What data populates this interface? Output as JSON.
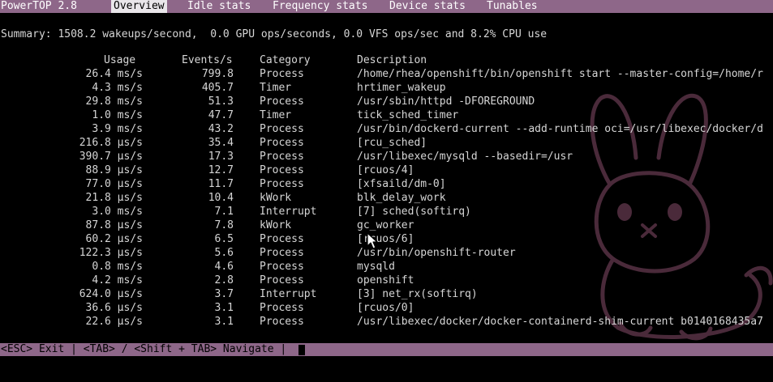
{
  "app": {
    "title": "PowerTOP 2.8"
  },
  "tabs": [
    {
      "label": "Overview",
      "active": true
    },
    {
      "label": "Idle stats",
      "active": false
    },
    {
      "label": "Frequency stats",
      "active": false
    },
    {
      "label": "Device stats",
      "active": false
    },
    {
      "label": "Tunables",
      "active": false
    }
  ],
  "summary": "Summary: 1508.2 wakeups/second,  0.0 GPU ops/seconds, 0.0 VFS ops/sec and 8.2% CPU use",
  "table": {
    "headers": {
      "usage": "Usage",
      "events": "Events/s",
      "category": "Category",
      "description": "Description"
    },
    "rows": [
      {
        "usage": "26.4 ms/s",
        "events": "799.8",
        "category": "Process",
        "description": "/home/rhea/openshift/bin/openshift start --master-config=/home/r"
      },
      {
        "usage": "4.3 ms/s",
        "events": "405.7",
        "category": "Timer",
        "description": "hrtimer_wakeup"
      },
      {
        "usage": "29.8 ms/s",
        "events": "51.3",
        "category": "Process",
        "description": "/usr/sbin/httpd -DFOREGROUND"
      },
      {
        "usage": "1.0 ms/s",
        "events": "47.7",
        "category": "Timer",
        "description": "tick_sched_timer"
      },
      {
        "usage": "3.9 ms/s",
        "events": "43.2",
        "category": "Process",
        "description": "/usr/bin/dockerd-current --add-runtime oci=/usr/libexec/docker/d"
      },
      {
        "usage": "216.8 µs/s",
        "events": "35.4",
        "category": "Process",
        "description": "[rcu_sched]"
      },
      {
        "usage": "390.7 µs/s",
        "events": "17.3",
        "category": "Process",
        "description": "/usr/libexec/mysqld --basedir=/usr"
      },
      {
        "usage": "88.9 µs/s",
        "events": "12.7",
        "category": "Process",
        "description": "[rcuos/4]"
      },
      {
        "usage": "77.0 µs/s",
        "events": "11.7",
        "category": "Process",
        "description": "[xfsaild/dm-0]"
      },
      {
        "usage": "21.8 µs/s",
        "events": "10.4",
        "category": "kWork",
        "description": "blk_delay_work"
      },
      {
        "usage": "3.0 ms/s",
        "events": "7.1",
        "category": "Interrupt",
        "description": "[7] sched(softirq)"
      },
      {
        "usage": "87.8 µs/s",
        "events": "7.8",
        "category": "kWork",
        "description": "gc_worker"
      },
      {
        "usage": "60.2 µs/s",
        "events": "6.5",
        "category": "Process",
        "description": "[rcuos/6]"
      },
      {
        "usage": "122.3 µs/s",
        "events": "5.6",
        "category": "Process",
        "description": "/usr/bin/openshift-router"
      },
      {
        "usage": "0.8 ms/s",
        "events": "4.6",
        "category": "Process",
        "description": "mysqld"
      },
      {
        "usage": "4.2 ms/s",
        "events": "2.8",
        "category": "Process",
        "description": "openshift"
      },
      {
        "usage": "624.0 µs/s",
        "events": "3.7",
        "category": "Interrupt",
        "description": "[3] net_rx(softirq)"
      },
      {
        "usage": "36.6 µs/s",
        "events": "3.1",
        "category": "Process",
        "description": "[rcuos/0]"
      },
      {
        "usage": "22.6 µs/s",
        "events": "3.1",
        "category": "Process",
        "description": "/usr/libexec/docker/docker-containerd-shim-current b0140168435a7"
      }
    ]
  },
  "statusbar": {
    "help": "<ESC> Exit | <TAB> / <Shift + TAB> Navigate |"
  },
  "colors": {
    "bar_background": "#8e6789",
    "active_tab_background": "#e9e6ea",
    "terminal_background": "#000000",
    "text": "#d6d6d6",
    "watermark": "#4a2a3a"
  },
  "icons": {
    "watermark": "bunny-watermark-icon",
    "pointer": "mouse-pointer-icon"
  }
}
